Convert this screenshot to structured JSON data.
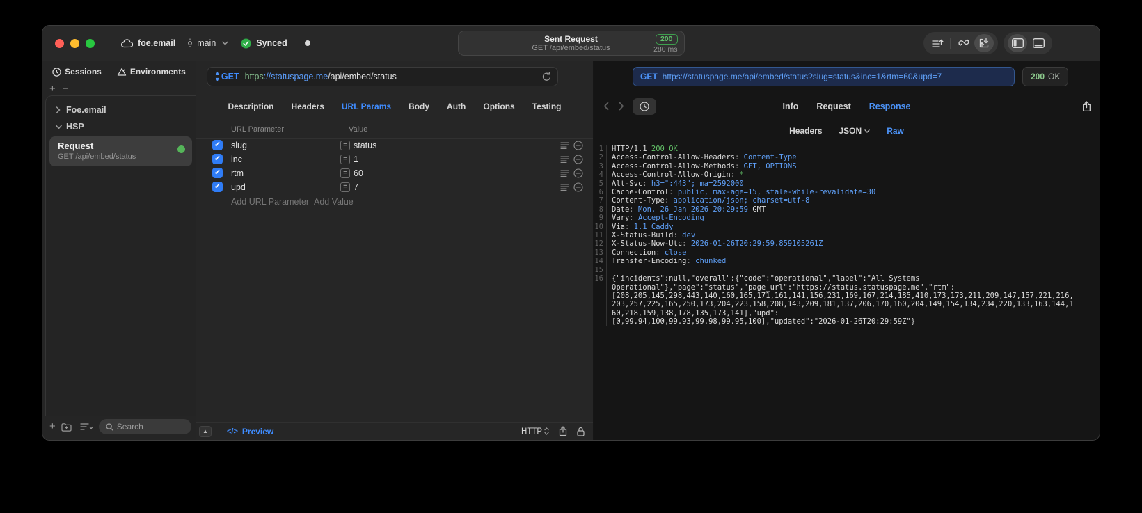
{
  "titlebar": {
    "project_name": "foe.email",
    "branch_name": "main",
    "sync_label": "Synced",
    "summary": {
      "title": "Sent Request",
      "subtitle": "GET /api/embed/status",
      "status_code": "200",
      "duration": "280 ms"
    }
  },
  "sidebar": {
    "tabs": [
      {
        "label": "Sessions"
      },
      {
        "label": "Environments"
      }
    ],
    "add_label": "+",
    "remove_label": "−",
    "tree": [
      {
        "label": "Foe.email"
      },
      {
        "label": "HSP"
      }
    ],
    "request_item": {
      "title": "Request",
      "subtitle": "GET /api/embed/status"
    },
    "search_placeholder": "Search"
  },
  "request_panel": {
    "method": "GET",
    "url_parts": {
      "scheme": "https",
      "host": "://statuspage.me",
      "path": "/api/embed/status"
    },
    "tabs": [
      "Description",
      "Headers",
      "URL Params",
      "Body",
      "Auth",
      "Options",
      "Testing"
    ],
    "active_tab": "URL Params",
    "params": {
      "columns": [
        "URL Parameter",
        "Value"
      ],
      "rows": [
        {
          "name": "slug",
          "value": "status",
          "enabled": true
        },
        {
          "name": "inc",
          "value": "1",
          "enabled": true
        },
        {
          "name": "rtm",
          "value": "60",
          "enabled": true
        },
        {
          "name": "upd",
          "value": "7",
          "enabled": true
        }
      ],
      "add_param_label": "Add URL Parameter",
      "add_value_label": "Add Value"
    },
    "footer": {
      "code_glyph": "</>",
      "preview_label": "Preview",
      "http_label": "HTTP"
    }
  },
  "response_panel": {
    "method": "GET",
    "url": "https://statuspage.me/api/embed/status?slug=status&inc=1&rtm=60&upd=7",
    "status_code": "200",
    "status_text": "OK",
    "tabs": [
      "Info",
      "Request",
      "Response"
    ],
    "active_tab": "Response",
    "subtabs": [
      "Headers",
      "JSON",
      "Raw"
    ],
    "active_subtab": "Raw",
    "code_lines": [
      {
        "n": "1",
        "segs": [
          [
            "HTTP/1.1 ",
            "w"
          ],
          [
            "200 OK",
            "g"
          ]
        ]
      },
      {
        "n": "2",
        "segs": [
          [
            "Access-Control-Allow-Headers",
            "w"
          ],
          [
            ": ",
            "d"
          ],
          [
            "Content-Type",
            "b"
          ]
        ]
      },
      {
        "n": "3",
        "segs": [
          [
            "Access-Control-Allow-Methods",
            "w"
          ],
          [
            ": ",
            "d"
          ],
          [
            "GET, OPTIONS",
            "b"
          ]
        ]
      },
      {
        "n": "4",
        "segs": [
          [
            "Access-Control-Allow-Origin",
            "w"
          ],
          [
            ": ",
            "d"
          ],
          [
            "*",
            "g"
          ]
        ]
      },
      {
        "n": "5",
        "segs": [
          [
            "Alt-Svc",
            "w"
          ],
          [
            ": ",
            "d"
          ],
          [
            "h3=\":443\"; ma=2592000",
            "b"
          ]
        ]
      },
      {
        "n": "6",
        "segs": [
          [
            "Cache-Control",
            "w"
          ],
          [
            ": ",
            "d"
          ],
          [
            "public, max-age=15, stale-while-revalidate=30",
            "b"
          ]
        ]
      },
      {
        "n": "7",
        "segs": [
          [
            "Content-Type",
            "w"
          ],
          [
            ": ",
            "d"
          ],
          [
            "application/json; charset=utf-8",
            "b"
          ]
        ]
      },
      {
        "n": "8",
        "segs": [
          [
            "Date",
            "w"
          ],
          [
            ": ",
            "d"
          ],
          [
            "Mon, 26 Jan 2026 20:29:59",
            "b"
          ],
          [
            " GMT",
            "w"
          ]
        ]
      },
      {
        "n": "9",
        "segs": [
          [
            "Vary",
            "w"
          ],
          [
            ": ",
            "d"
          ],
          [
            "Accept-Encoding",
            "b"
          ]
        ]
      },
      {
        "n": "10",
        "segs": [
          [
            "Via",
            "w"
          ],
          [
            ": ",
            "d"
          ],
          [
            "1.1 Caddy",
            "b"
          ]
        ]
      },
      {
        "n": "11",
        "segs": [
          [
            "X-Status-Build",
            "w"
          ],
          [
            ": ",
            "d"
          ],
          [
            "dev",
            "b"
          ]
        ]
      },
      {
        "n": "12",
        "segs": [
          [
            "X-Status-Now-Utc",
            "w"
          ],
          [
            ": ",
            "d"
          ],
          [
            "2026-01-26T20:29:59.859105261Z",
            "b"
          ]
        ]
      },
      {
        "n": "13",
        "segs": [
          [
            "Connection",
            "w"
          ],
          [
            ": ",
            "d"
          ],
          [
            "close",
            "b"
          ]
        ]
      },
      {
        "n": "14",
        "segs": [
          [
            "Transfer-Encoding",
            "w"
          ],
          [
            ": ",
            "d"
          ],
          [
            "chunked",
            "b"
          ]
        ]
      },
      {
        "n": "15",
        "segs": []
      },
      {
        "n": "16",
        "segs": [
          [
            "{\"incidents\":null,\"overall\":{\"code\":\"operational\",\"label\":\"All Systems\nOperational\"},\"page\":\"status\",\"page_url\":\"https://status.statuspage.me\",\"rtm\":\n[208,205,145,298,443,140,160,165,171,161,141,156,231,169,167,214,185,410,173,173,211,209,147,157,221,216,\n203,257,225,165,250,173,204,223,158,208,143,209,181,137,206,170,160,204,149,154,134,234,220,133,163,144,1\n60,218,159,138,178,135,173,141],\"upd\":\n[0,99.94,100,99.93,99.98,99.95,100],\"updated\":\"2026-01-26T20:29:59Z\"}",
            "w"
          ]
        ]
      }
    ]
  },
  "colors": {
    "accent_blue": "#4c93f8",
    "value_green": "#63c168",
    "badge_green": "#5fc46a",
    "checkbox_blue": "#2f7cf6",
    "request_dot_green": "#55b559",
    "traffic_red": "#ff5f57",
    "traffic_yellow": "#febc2e",
    "traffic_green": "#28c840"
  }
}
